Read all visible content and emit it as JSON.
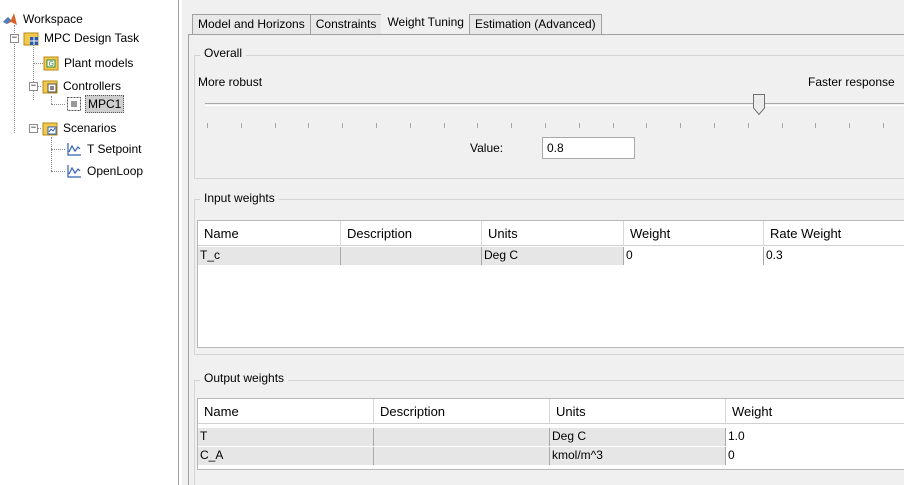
{
  "tree": {
    "workspace": "Workspace",
    "task": "MPC Design Task",
    "plant_models": "Plant models",
    "controllers": "Controllers",
    "mpc1": "MPC1",
    "scenarios": "Scenarios",
    "t_setpoint": "T Setpoint",
    "openloop": "OpenLoop",
    "expand_minus": "−"
  },
  "tabs": [
    "Model and Horizons",
    "Constraints",
    "Weight Tuning",
    "Estimation (Advanced)"
  ],
  "overall": {
    "title": "Overall",
    "left_label": "More robust",
    "right_label": "Faster response",
    "value_label": "Value:",
    "value": "0.8",
    "slider_position": 0.8
  },
  "input_weights": {
    "title": "Input weights",
    "columns": [
      "Name",
      "Description",
      "Units",
      "Weight",
      "Rate Weight"
    ],
    "rows": [
      [
        "T_c",
        "",
        "Deg C",
        "0",
        "0.3"
      ]
    ]
  },
  "output_weights": {
    "title": "Output weights",
    "columns": [
      "Name",
      "Description",
      "Units",
      "Weight"
    ],
    "rows": [
      [
        "T",
        "",
        "Deg C",
        "1.0"
      ],
      [
        "C_A",
        "",
        "kmol/m^3",
        "0"
      ]
    ]
  },
  "colors": {
    "folder": "#f2c94c",
    "selection": "#cfcfcf",
    "panel_bg": "#f0f0f0"
  }
}
